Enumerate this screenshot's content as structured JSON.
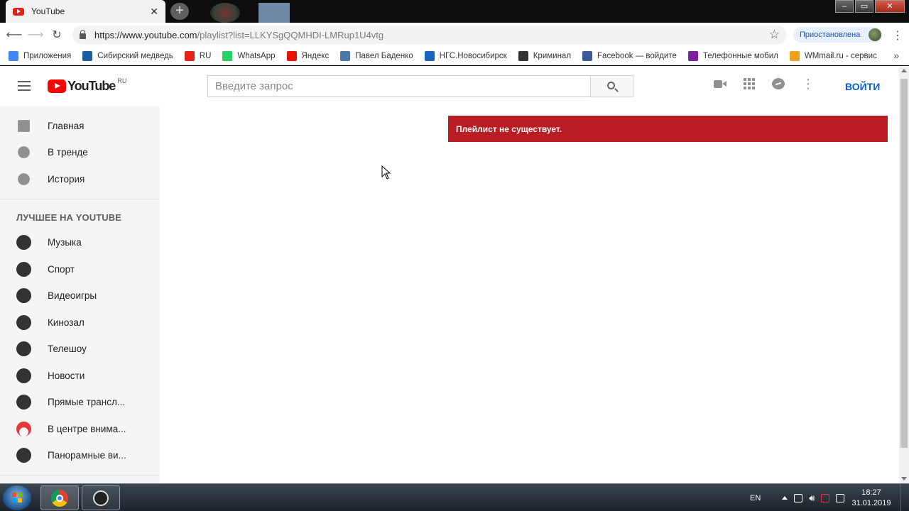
{
  "browser": {
    "tab_title": "YouTube",
    "tab_close": "✕",
    "new_tab": "+",
    "window_controls": [
      "–",
      "▭",
      "✕"
    ],
    "url_host": "https://www.youtube.com",
    "url_path": "/playlist?list=LLKYSgQQMHDI-LMRup1U4vtg",
    "profile_status": "Приостановлена",
    "bookmarks": [
      {
        "label": "Приложения",
        "icon": "apps-grid-icon",
        "color": "#4285f4"
      },
      {
        "label": "Сибирский медведь",
        "icon": "bear-icon",
        "color": "#1a5fa0"
      },
      {
        "label": "RU",
        "icon": "youtube-icon",
        "color": "#e62117"
      },
      {
        "label": "WhatsApp",
        "icon": "whatsapp-icon",
        "color": "#25d366"
      },
      {
        "label": "Яндекс",
        "icon": "yandex-icon",
        "color": "#e61400"
      },
      {
        "label": "Павел Баденко",
        "icon": "vk-icon",
        "color": "#4a76a8"
      },
      {
        "label": "НГС.Новосибирск",
        "icon": "ngs-icon",
        "color": "#1565c0"
      },
      {
        "label": "Криминал",
        "icon": "film-icon",
        "color": "#333333"
      },
      {
        "label": "Facebook — войдите",
        "icon": "facebook-icon",
        "color": "#3b5998"
      },
      {
        "label": "Телефонные мобил",
        "icon": "phone-shop-icon",
        "color": "#7b1fa2"
      },
      {
        "label": "WMmail.ru - сервис",
        "icon": "wmmail-icon",
        "color": "#f0a020"
      }
    ]
  },
  "youtube": {
    "logo_text": "YouTube",
    "country": "RU",
    "search_placeholder": "Введите запрос",
    "sign_in": "ВОЙТИ",
    "guide_main": [
      {
        "label": "Главная",
        "icon": "home-icon"
      },
      {
        "label": "В тренде",
        "icon": "flame-icon"
      },
      {
        "label": "История",
        "icon": "history-icon"
      }
    ],
    "guide_section_title": "ЛУЧШЕЕ НА YOUTUBE",
    "guide_best": [
      {
        "label": "Музыка",
        "icon": "music-icon"
      },
      {
        "label": "Спорт",
        "icon": "sport-icon"
      },
      {
        "label": "Видеоигры",
        "icon": "gaming-icon"
      },
      {
        "label": "Кинозал",
        "icon": "movies-icon"
      },
      {
        "label": "Телешоу",
        "icon": "tv-icon"
      },
      {
        "label": "Новости",
        "icon": "news-icon"
      },
      {
        "label": "Прямые трансл...",
        "icon": "live-icon"
      },
      {
        "label": "В центре внима...",
        "icon": "spotlight-icon"
      },
      {
        "label": "Панорамные ви...",
        "icon": "vr-icon"
      }
    ],
    "alert_message": "Плейлист не существует.",
    "alert_color": "#b91c23"
  },
  "taskbar": {
    "language": "EN",
    "time": "18:27",
    "date": "31.01.2019"
  }
}
